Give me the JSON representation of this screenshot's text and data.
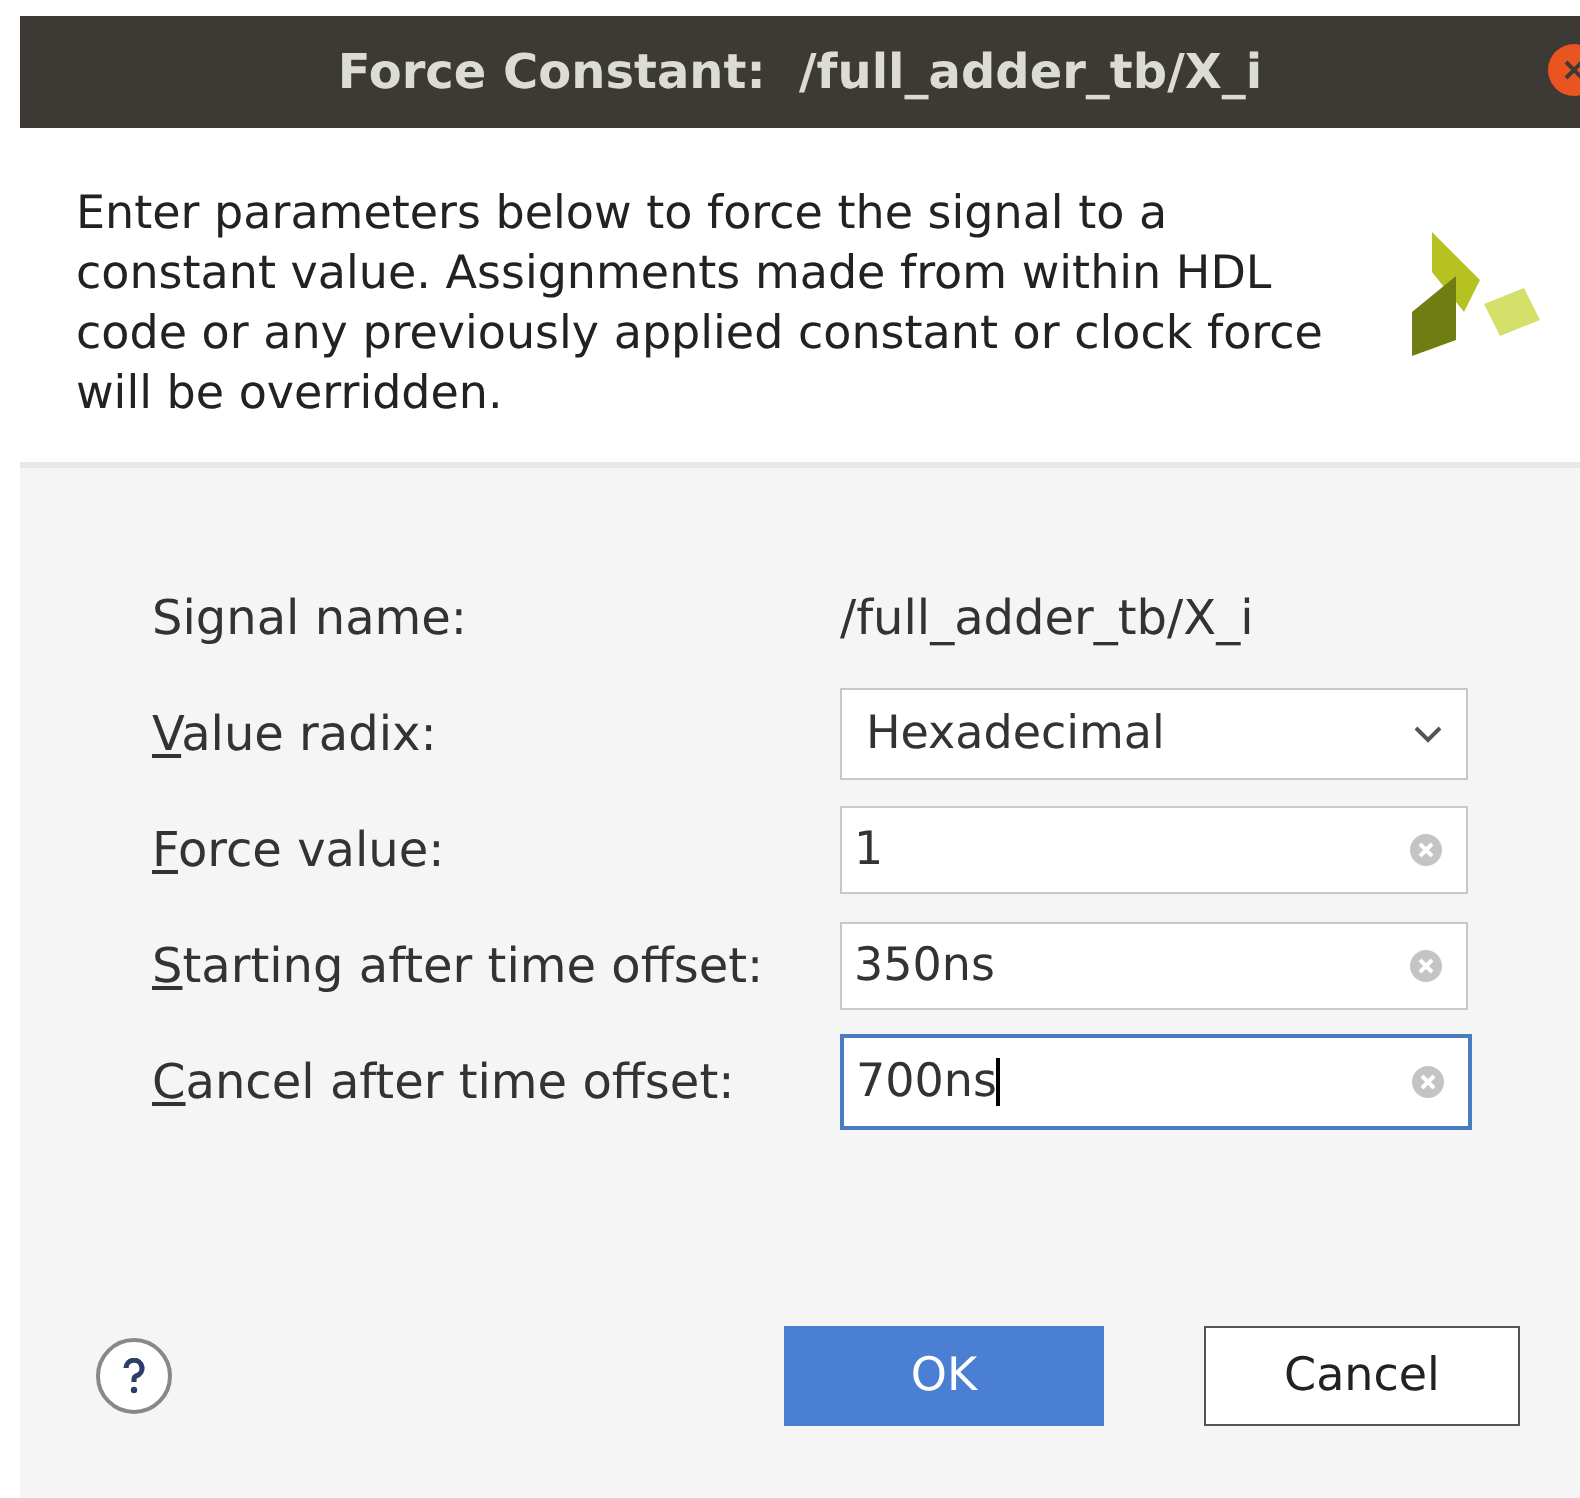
{
  "window": {
    "title": "Force Constant:  /full_adder_tb/X_i"
  },
  "description": "Enter parameters below to force the signal to a constant value. Assignments made from within HDL code or any previously applied constant or clock force will be overridden.",
  "fields": [
    {
      "kind": "static",
      "label": "Signal name:",
      "underline_first": false,
      "value": "/full_adder_tb/X_i"
    },
    {
      "kind": "select",
      "label": "Value radix:",
      "underline_first": true,
      "value": "Hexadecimal"
    },
    {
      "kind": "text",
      "label": "Force value:",
      "underline_first": true,
      "value": "1",
      "focused": false
    },
    {
      "kind": "text",
      "label": "Starting after time offset:",
      "underline_first": true,
      "value": "350ns",
      "focused": false
    },
    {
      "kind": "text",
      "label": "Cancel after time offset:",
      "underline_first": true,
      "value": "700ns",
      "focused": true
    }
  ],
  "buttons": [
    {
      "label": "OK",
      "kind": "primary"
    },
    {
      "label": "Cancel",
      "kind": "secondary"
    }
  ]
}
